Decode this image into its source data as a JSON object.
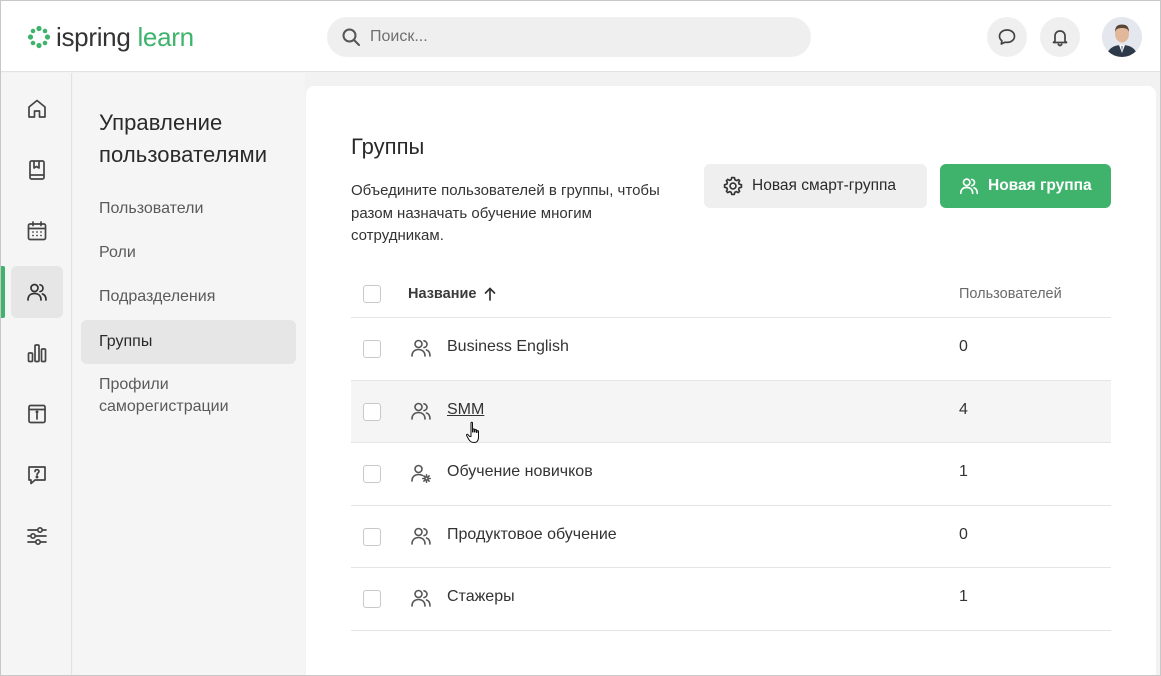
{
  "header": {
    "logo": {
      "brand": "ispring",
      "product": "learn"
    },
    "search": {
      "placeholder": "Поиск..."
    },
    "icons": [
      "chat-icon",
      "bell-icon"
    ],
    "avatar": "user-avatar"
  },
  "rail": {
    "items": [
      {
        "name": "home",
        "icon": "home-icon"
      },
      {
        "name": "library",
        "icon": "book-icon"
      },
      {
        "name": "calendar",
        "icon": "calendar-icon"
      },
      {
        "name": "users",
        "icon": "users-icon",
        "active": true
      },
      {
        "name": "reports",
        "icon": "bar-chart-icon"
      },
      {
        "name": "news",
        "icon": "info-board-icon"
      },
      {
        "name": "help",
        "icon": "question-chat-icon"
      },
      {
        "name": "settings",
        "icon": "sliders-icon"
      }
    ]
  },
  "submenu": {
    "title": "Управление пользователями",
    "items": [
      {
        "label": "Пользователи"
      },
      {
        "label": "Роли"
      },
      {
        "label": "Подразделения"
      },
      {
        "label": "Группы",
        "active": true
      },
      {
        "label": "Профили саморегистрации"
      }
    ]
  },
  "page": {
    "title": "Группы",
    "description": "Объедините пользователей в группы, чтобы разом назначать обучение многим сотрудникам.",
    "buttons": {
      "smart_group": "Новая смарт-группа",
      "new_group": "Новая группа"
    }
  },
  "table": {
    "columns": {
      "name": "Название",
      "count": "Пользователей"
    },
    "sort": "ascending",
    "rows": [
      {
        "name": "Business English",
        "count": "0",
        "icon": "users-icon"
      },
      {
        "name": "SMM",
        "count": "4",
        "icon": "users-icon",
        "hover": true
      },
      {
        "name": "Обучение новичков",
        "count": "1",
        "icon": "user-gear-icon"
      },
      {
        "name": "Продуктовое обучение",
        "count": "0",
        "icon": "users-icon"
      },
      {
        "name": "Стажеры",
        "count": "1",
        "icon": "users-icon"
      }
    ]
  },
  "colors": {
    "accent": "#3fb36c",
    "background": "#f2f2f2",
    "card": "#ffffff",
    "button_secondary": "#efefef"
  }
}
